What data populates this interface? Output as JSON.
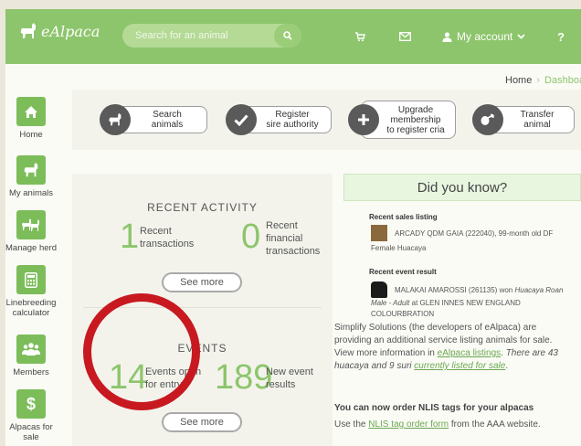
{
  "header": {
    "logo_text": "eAlpaca",
    "search_placeholder": "Search for an animal",
    "account_label": "My account",
    "help_label": "?"
  },
  "breadcrumb": {
    "home": "Home",
    "separator": "›",
    "current": "Dashboar"
  },
  "sidebar": {
    "items": [
      {
        "label": "Home",
        "icon": "home-icon"
      },
      {
        "label": "My animals",
        "icon": "alpaca-icon"
      },
      {
        "label": "Manage herd",
        "icon": "herd-icon"
      },
      {
        "label": "Linebreeding calculator",
        "icon": "calculator-icon"
      },
      {
        "label": "Members",
        "icon": "members-icon"
      },
      {
        "label": "Alpacas for sale",
        "icon": "dollar-icon"
      }
    ]
  },
  "actions": [
    {
      "line1": "Search",
      "line2": "animals",
      "icon": "alpaca-icon"
    },
    {
      "line1": "Register",
      "line2": "sire authority",
      "icon": "check-icon"
    },
    {
      "line1": "Upgrade",
      "line2": "membership",
      "line3": "to register cria",
      "icon": "plus-icon"
    },
    {
      "line1": "Transfer",
      "line2": "animal",
      "icon": "transfer-icon"
    }
  ],
  "recent_activity": {
    "title": "RECENT ACTIVITY",
    "transactions_count": "1",
    "transactions_line1": "Recent",
    "transactions_line2": "transactions",
    "financial_count": "0",
    "financial_line1": "Recent",
    "financial_line2": "financial",
    "financial_line3": "transactions",
    "see_more": "See more"
  },
  "events": {
    "title": "EVENTS",
    "open_count": "14",
    "open_line1": "Events open",
    "open_line2": "for entry",
    "results_count": "189",
    "results_line1": "New event",
    "results_line2": "results",
    "see_more": "See more"
  },
  "did_you_know": {
    "title": "Did you know?",
    "recent_sales_label": "Recent sales listing",
    "sales_line1": "ARCADY QDM GAIA (222040), 99-month old DF",
    "sales_line2": "Female Huacaya",
    "recent_event_label": "Recent event result",
    "event_line1_a": "MALAKAI AMAROSSI (261135) won ",
    "event_line1_b": "Huacaya Roan",
    "event_line2_a": "Male - Adult",
    "event_line2_b": " at GLEN INNES NEW ENGLAND",
    "event_line3": "COLOURBRATION",
    "para1_a": "Simplify Solutions (the developers of eAlpaca) are providing an additional service listing animals for sale. View more information in ",
    "para1_link1": "eAlpaca listings",
    "para1_b": ". ",
    "para1_c": "There are 43 huacaya and 9 suri ",
    "para1_link2": "currently listed for sale",
    "para1_d": ".",
    "nlis_heading": "You can now order NLIS tags for your alpacas",
    "nlis_a": "Use the ",
    "nlis_link": "NLIS tag order form",
    "nlis_b": " from the AAA website."
  },
  "colors": {
    "brand_green": "#8dc56c",
    "tile_green": "#7cbd5a",
    "highlight_red": "#c81921"
  }
}
